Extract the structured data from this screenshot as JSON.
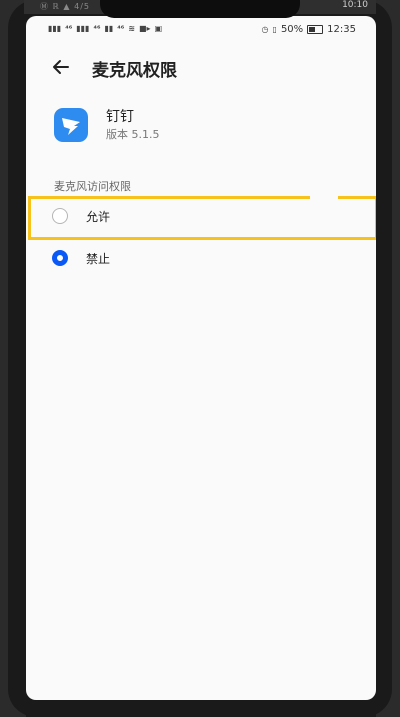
{
  "device": {
    "top_clock": "10:10",
    "top_faint": "Ⓜ ℝ ▲ 4/5"
  },
  "statusbar": {
    "left_signals": [
      "⁴⁶",
      "⁴⁶",
      "⁴⁶",
      "⁴⁶"
    ],
    "battery_percent": "50%",
    "time": "12:35"
  },
  "header": {
    "back_icon": "arrow-left-icon",
    "title": "麦克风权限"
  },
  "app": {
    "icon": "dingtalk-icon",
    "name": "钉钉",
    "version": "版本 5.1.5"
  },
  "permission": {
    "section_label": "麦克风访问权限",
    "options": [
      {
        "label": "允许",
        "selected": false
      },
      {
        "label": "禁止",
        "selected": true
      }
    ]
  },
  "colors": {
    "accent": "#0a59f7",
    "highlight": "#f6c21b",
    "app_icon_bg": "#2e8cf0"
  }
}
